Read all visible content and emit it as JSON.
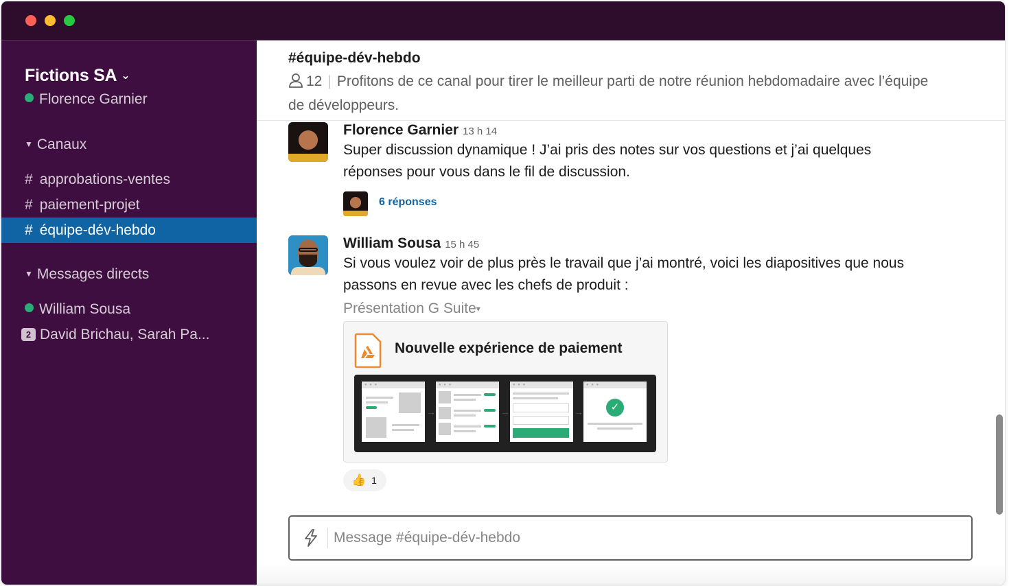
{
  "window": {
    "traffic_lights": [
      "close",
      "minimize",
      "maximize"
    ]
  },
  "sidebar": {
    "workspace_name": "Fictions SA",
    "workspace_chevron": "⌄",
    "current_user": "Florence Garnier",
    "channels_header": "Canaux",
    "channels": [
      {
        "prefix": "#",
        "name": "approbations-ventes",
        "active": false
      },
      {
        "prefix": "#",
        "name": "paiement-projet",
        "active": false
      },
      {
        "prefix": "#",
        "name": "équipe-dév-hebdo",
        "active": true
      }
    ],
    "dm_header": "Messages directs",
    "direct_messages": [
      {
        "name": "William Sousa",
        "status": "online"
      },
      {
        "name": "David Brichau, Sarah Pa...",
        "badge": "2"
      }
    ]
  },
  "channel": {
    "title": "#équipe-dév-hebdo",
    "member_count": "12",
    "separator": "|",
    "description": "Profitons de ce canal pour tirer le meilleur parti de notre réunion hebdomadaire avec l’équipe de développeurs."
  },
  "messages": [
    {
      "author": "Florence Garnier",
      "time": "13 h 14",
      "text": "Super discussion dynamique ! J’ai pris des notes sur vos questions et j’ai quelques réponses pour vous dans le fil de discussion.",
      "thread_replies": "6 réponses"
    },
    {
      "author": "William Sousa",
      "time": "15 h 45",
      "text": "Si vous voulez voir de plus près le travail que j’ai montré, voici les diapositives que nous passons en revue avec les chefs de produit :",
      "attachment": {
        "source_label": "Présentation G Suite",
        "caret": "▾",
        "title": "Nouvelle expérience de paiement",
        "arrow": "→",
        "frame_dots": "● ● ●",
        "check": "✓"
      },
      "reaction": {
        "emoji": "👍",
        "count": "1"
      }
    }
  ],
  "composer": {
    "placeholder": "Message #équipe-dév-hebdo"
  },
  "colors": {
    "sidebar_bg": "#3f0e40",
    "titlebar_bg": "#2e0c2c",
    "active_channel": "#1164a3",
    "presence_green": "#2bac76",
    "link_blue": "#1264a3",
    "slides_orange": "#f0882c"
  }
}
